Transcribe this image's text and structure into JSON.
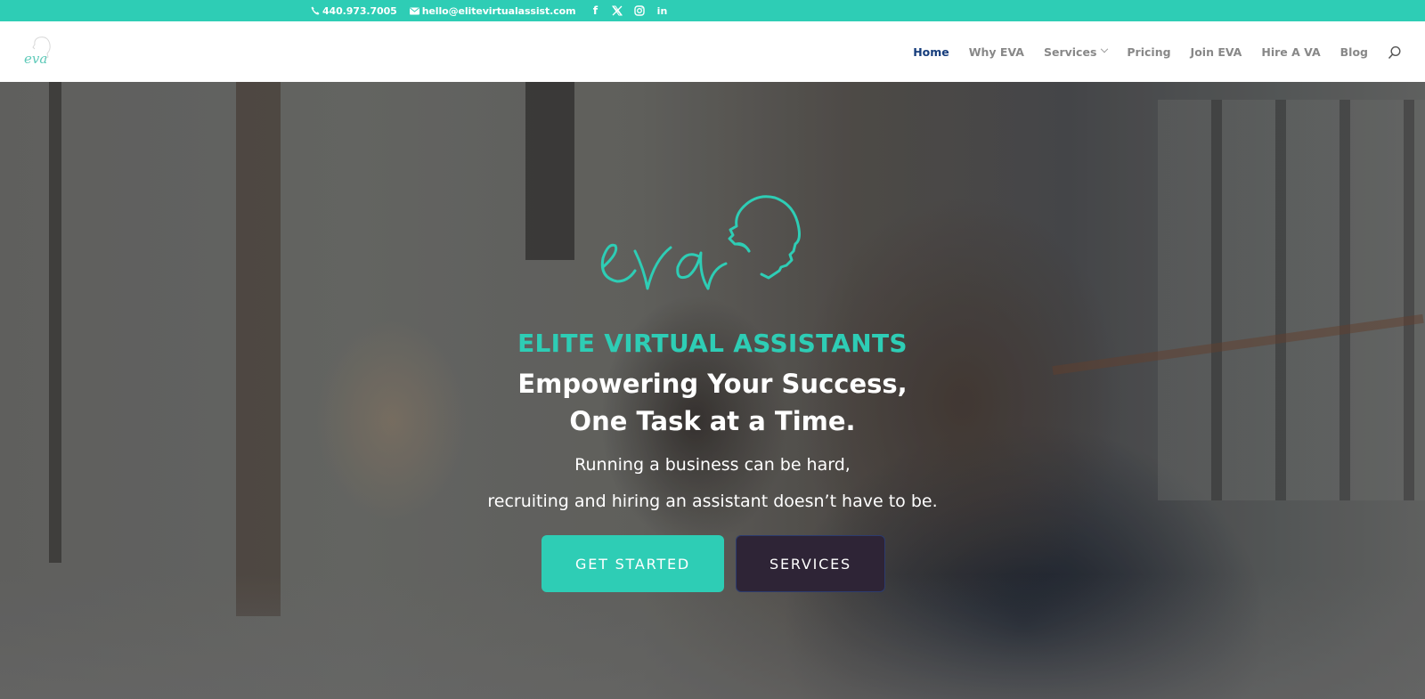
{
  "topbar": {
    "phone": "440.973.7005",
    "email": "hello@elitevirtualassist.com",
    "phone_icon": "phone-icon",
    "email_icon": "envelope-icon",
    "social": [
      {
        "name": "facebook-icon",
        "glyph": "f"
      },
      {
        "name": "x-twitter-icon",
        "glyph": "𝕏"
      },
      {
        "name": "instagram-icon",
        "glyph": "◎"
      },
      {
        "name": "linkedin-icon",
        "glyph": "in"
      }
    ],
    "background": "#2ecdb5"
  },
  "header": {
    "logo_text": "eva",
    "nav": [
      {
        "label": "Home",
        "active": true
      },
      {
        "label": "Why EVA"
      },
      {
        "label": "Services",
        "has_dropdown": true
      },
      {
        "label": "Pricing"
      },
      {
        "label": "Join EVA"
      },
      {
        "label": "Hire A VA"
      },
      {
        "label": "Blog"
      }
    ],
    "search_icon": "search-icon",
    "active_color": "#163d7c"
  },
  "hero": {
    "logo_text": "eva",
    "eyebrow": "ELITE VIRTUAL ASSISTANTS",
    "headline_line1": "Empowering Your Success,",
    "headline_line2": "One Task at a Time.",
    "sub_line1": "Running a business can be hard,",
    "sub_line2": "recruiting and hiring an assistant doesn’t have to be.",
    "primary_button": "GET STARTED",
    "secondary_button": "SERVICES",
    "accent_color": "#2ecdb5",
    "secondary_color": "#2e2436"
  }
}
